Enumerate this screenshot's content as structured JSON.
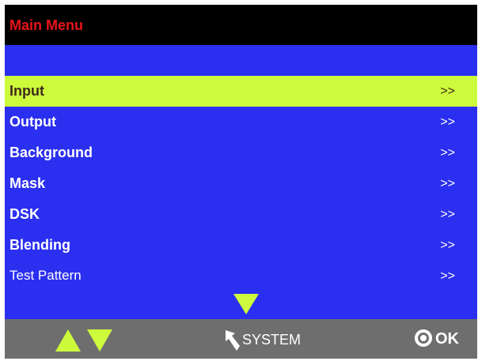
{
  "header": {
    "title": "Main Menu"
  },
  "menu": {
    "items": [
      {
        "label": "Input",
        "arrow": ">>",
        "selected": true
      },
      {
        "label": "Output",
        "arrow": ">>"
      },
      {
        "label": "Background",
        "arrow": ">>"
      },
      {
        "label": "Mask",
        "arrow": ">>"
      },
      {
        "label": "DSK",
        "arrow": ">>"
      },
      {
        "label": "Blending",
        "arrow": ">>"
      },
      {
        "label": "Test Pattern",
        "arrow": ">>"
      }
    ]
  },
  "footer": {
    "system_label": "SYSTEM",
    "ok_label": "OK"
  },
  "icons": {
    "scroll": "chevron-down-icon",
    "nav_up": "triangle-up-icon",
    "nav_down": "triangle-down-icon",
    "back": "back-arrow-icon",
    "ok": "ok-knob-icon"
  },
  "colors": {
    "screen_bg": "#2b2ff0",
    "title_bg": "#000000",
    "title_text": "#e8141a",
    "highlight": "#cdfb3b",
    "footer_bg": "#6f6e6f"
  }
}
